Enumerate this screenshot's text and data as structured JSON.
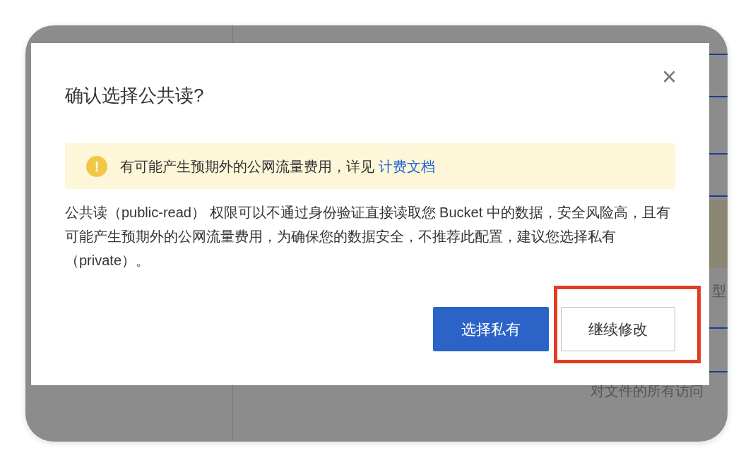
{
  "background": {
    "texts": [
      {
        "text": "型",
        "kind": "side"
      },
      {
        "text": "对文件的所有访问",
        "kind": "hint"
      }
    ]
  },
  "dialog": {
    "title": "确认选择公共读?",
    "close": "×",
    "alert": {
      "text": "有可能产生预期外的公网流量费用，详见",
      "link": "计费文档",
      "icon": "!"
    },
    "body": "公共读（public-read） 权限可以不通过身份验证直接读取您 Bucket 中的数据，安全风险高，且有可能产生预期外的公网流量费用，为确保您的数据安全，不推荐此配置，建议您选择私有（private）。",
    "buttons": [
      {
        "label": "选择私有",
        "kind": "primary",
        "highlighted": false
      },
      {
        "label": "继续修改",
        "kind": "secondary",
        "highlighted": true
      }
    ]
  }
}
